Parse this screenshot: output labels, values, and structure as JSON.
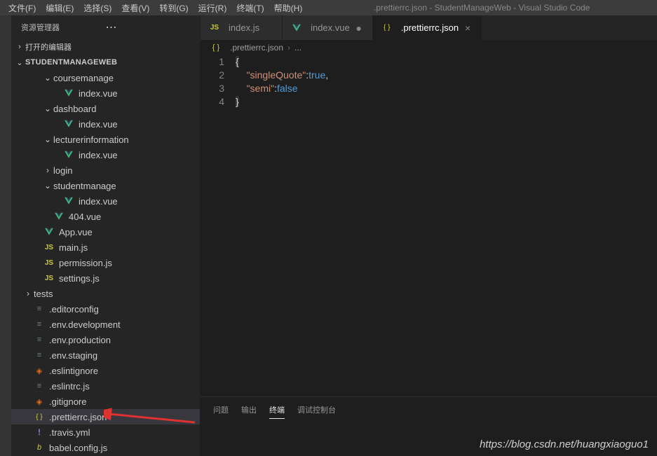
{
  "window": {
    "title": ".prettierrc.json - StudentManageWeb - Visual Studio Code"
  },
  "menu": {
    "file": "文件(F)",
    "edit": "编辑(E)",
    "select": "选择(S)",
    "view": "查看(V)",
    "go": "转到(G)",
    "run": "运行(R)",
    "terminal": "终端(T)",
    "help": "帮助(H)"
  },
  "sidebar": {
    "title": "资源管理器",
    "sections": {
      "open_editors": "打开的编辑器",
      "project": "STUDENTMANAGEWEB"
    },
    "tree": [
      {
        "label": "coursemanage",
        "type": "folder",
        "open": true,
        "depth": 2
      },
      {
        "label": "index.vue",
        "type": "vue",
        "depth": 3
      },
      {
        "label": "dashboard",
        "type": "folder",
        "open": true,
        "depth": 2
      },
      {
        "label": "index.vue",
        "type": "vue",
        "depth": 3
      },
      {
        "label": "lecturerinformation",
        "type": "folder",
        "open": true,
        "depth": 2
      },
      {
        "label": "index.vue",
        "type": "vue",
        "depth": 3
      },
      {
        "label": "login",
        "type": "folder",
        "open": false,
        "depth": 2
      },
      {
        "label": "studentmanage",
        "type": "folder",
        "open": true,
        "depth": 2
      },
      {
        "label": "index.vue",
        "type": "vue",
        "depth": 3
      },
      {
        "label": "404.vue",
        "type": "vue",
        "depth": 2
      },
      {
        "label": "App.vue",
        "type": "vue",
        "depth": 1
      },
      {
        "label": "main.js",
        "type": "js",
        "depth": 1
      },
      {
        "label": "permission.js",
        "type": "js",
        "depth": 1
      },
      {
        "label": "settings.js",
        "type": "js",
        "depth": 1
      },
      {
        "label": "tests",
        "type": "folder",
        "open": false,
        "depth": 0
      },
      {
        "label": ".editorconfig",
        "type": "conf",
        "depth": 0
      },
      {
        "label": ".env.development",
        "type": "conf",
        "depth": 0
      },
      {
        "label": ".env.production",
        "type": "conf",
        "depth": 0
      },
      {
        "label": ".env.staging",
        "type": "conf",
        "depth": 0
      },
      {
        "label": ".eslintignore",
        "type": "git",
        "depth": 0
      },
      {
        "label": ".eslintrc.js",
        "type": "conf",
        "depth": 0
      },
      {
        "label": ".gitignore",
        "type": "git",
        "depth": 0
      },
      {
        "label": ".prettierrc.json",
        "type": "json",
        "depth": 0,
        "selected": true
      },
      {
        "label": ".travis.yml",
        "type": "yaml",
        "depth": 0
      },
      {
        "label": "babel.config.js",
        "type": "babel",
        "depth": 0
      }
    ]
  },
  "tabs": [
    {
      "label": "index.js",
      "type": "js",
      "active": false,
      "dirty": false
    },
    {
      "label": "index.vue",
      "type": "vue",
      "active": false,
      "dirty": true
    },
    {
      "label": ".prettierrc.json",
      "type": "json",
      "active": true,
      "dirty": false
    }
  ],
  "breadcrumb": {
    "file": ".prettierrc.json",
    "sep": "›",
    "rest": "..."
  },
  "code": {
    "lines": [
      "1",
      "2",
      "3",
      "4"
    ],
    "l1_open": "{",
    "l2_key": "\"singleQuote\"",
    "l2_colon": ":",
    "l2_val": "true",
    "l2_comma": ",",
    "l3_key": "\"semi\"",
    "l3_colon": ":",
    "l3_val": "false",
    "l4_close": "}"
  },
  "panel": {
    "tabs": {
      "problems": "问题",
      "output": "输出",
      "terminal": "终端",
      "debug": "调试控制台"
    }
  },
  "watermark": "https://blog.csdn.net/huangxiaoguo1"
}
